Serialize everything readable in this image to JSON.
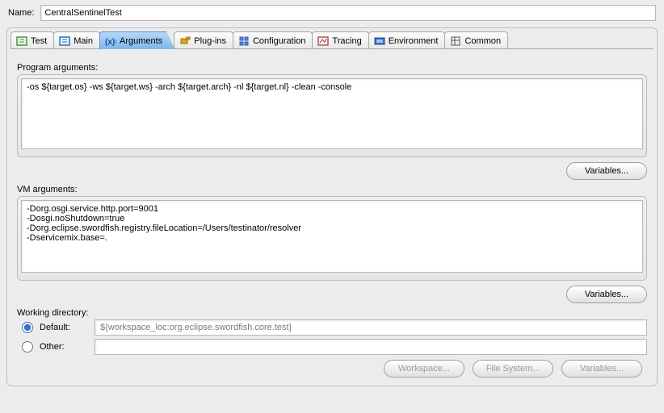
{
  "name_label": "Name:",
  "name_value": "CentralSentinelTest",
  "tabs": [
    {
      "label": "Test",
      "icon": "test-icon"
    },
    {
      "label": "Main",
      "icon": "main-icon"
    },
    {
      "label": "Arguments",
      "icon": "arguments-icon"
    },
    {
      "label": "Plug-ins",
      "icon": "plugins-icon"
    },
    {
      "label": "Configuration",
      "icon": "configuration-icon"
    },
    {
      "label": "Tracing",
      "icon": "tracing-icon"
    },
    {
      "label": "Environment",
      "icon": "environment-icon"
    },
    {
      "label": "Common",
      "icon": "common-icon"
    }
  ],
  "program_args": {
    "label": "Program arguments:",
    "value": "-os ${target.os} -ws ${target.ws} -arch ${target.arch} -nl ${target.nl} -clean -console",
    "variables_btn": "Variables..."
  },
  "vm_args": {
    "label": "VM arguments:",
    "value": "-Dorg.osgi.service.http.port=9001\n-Dosgi.noShutdown=true\n-Dorg.eclipse.swordfish.registry.fileLocation=/Users/testinator/resolver\n-Dservicemix.base=.",
    "variables_btn": "Variables..."
  },
  "working_dir": {
    "label": "Working directory:",
    "default_label": "Default:",
    "default_value": "${workspace_loc:org.eclipse.swordfish.core.test}",
    "other_label": "Other:",
    "other_value": "",
    "workspace_btn": "Workspace...",
    "filesystem_btn": "File System...",
    "variables_btn": "Variables..."
  }
}
